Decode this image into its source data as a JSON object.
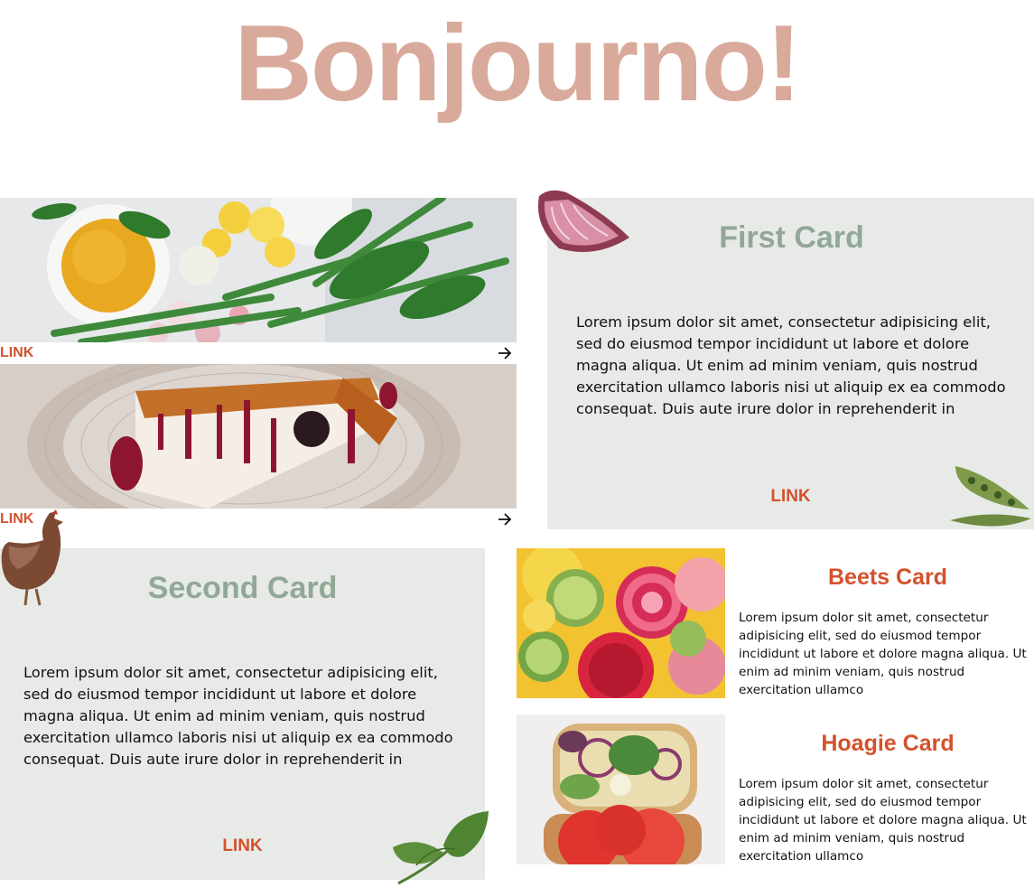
{
  "page": {
    "heading": "Bonjourno!",
    "colors": {
      "heading": "#d9aa9b",
      "accent": "#d4512c",
      "card_bg": "#e7eae7",
      "card_title": "#92a896"
    }
  },
  "image_links": [
    {
      "link_label": "LINK",
      "arrow_icon": "arrow-right-icon",
      "image": "vegetables-and-sauce-photo"
    },
    {
      "link_label": "LINK",
      "arrow_icon": "arrow-right-icon",
      "image": "cheesecake-photo"
    }
  ],
  "first_card": {
    "title": "First Card",
    "body": "Lorem ipsum dolor sit amet, consectetur adipisicing elit, sed do eiusmod tempor incididunt ut labore et dolore magna aliqua. Ut enim ad minim veniam, quis nostrud exercitation ullamco laboris nisi ut aliquip ex ea commodo consequat. Duis aute irure dolor in reprehenderit in",
    "link_label": "LINK",
    "decorations": [
      "red-onion-icon",
      "pea-pod-icon"
    ]
  },
  "second_card": {
    "title": "Second Card",
    "body": "Lorem ipsum dolor sit amet, consectetur adipisicing elit, sed do eiusmod tempor incididunt ut labore et dolore magna aliqua. Ut enim ad minim veniam, quis nostrud exercitation ullamco laboris nisi ut aliquip ex ea commodo consequat. Duis aute irure dolor in reprehenderit in",
    "link_label": "LINK",
    "decorations": [
      "chicken-icon",
      "basil-leaf-icon"
    ]
  },
  "small_cards": [
    {
      "title": "Beets Card",
      "body": "Lorem ipsum dolor sit amet, consectetur adipisicing elit, sed do eiusmod tempor incididunt ut labore et dolore magna aliqua. Ut enim ad minim veniam, quis nostrud exercitation ullamco",
      "image": "beets-salad-photo"
    },
    {
      "title": "Hoagie Card",
      "body": "Lorem ipsum dolor sit amet, consectetur adipisicing elit, sed do eiusmod tempor incididunt ut labore et dolore magna aliqua. Ut enim ad minim veniam, quis nostrud exercitation ullamco",
      "image": "hoagie-sandwich-photo"
    }
  ]
}
